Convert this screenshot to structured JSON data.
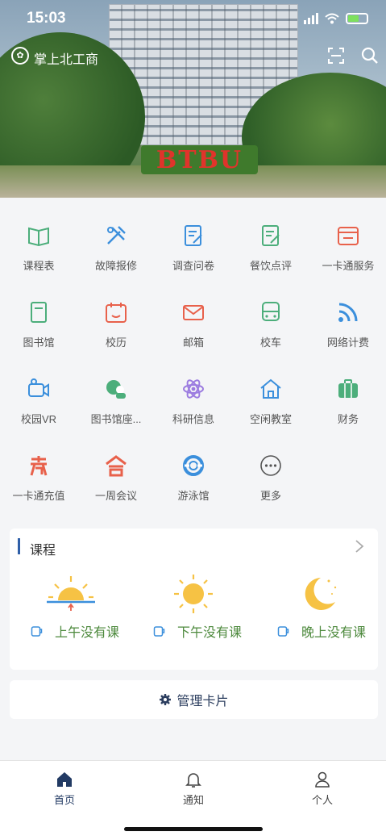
{
  "status_bar": {
    "time": "15:03"
  },
  "app_bar": {
    "title": "掌上北工商",
    "logo_glyph": "✿"
  },
  "hero": {
    "sign_text": "BTBU"
  },
  "services": [
    {
      "label": "课程表",
      "icon": "book-icon",
      "color": "#4cae7b"
    },
    {
      "label": "故障报修",
      "icon": "tools-icon",
      "color": "#3b8fdc"
    },
    {
      "label": "调查问卷",
      "icon": "survey-icon",
      "color": "#3b8fdc"
    },
    {
      "label": "餐饮点评",
      "icon": "review-icon",
      "color": "#4cae7b"
    },
    {
      "label": "一卡通服务",
      "icon": "card-service-icon",
      "color": "#e8614b"
    },
    {
      "label": "图书馆",
      "icon": "library-icon",
      "color": "#4cae7b"
    },
    {
      "label": "校历",
      "icon": "calendar-icon",
      "color": "#e8614b"
    },
    {
      "label": "邮箱",
      "icon": "mail-icon",
      "color": "#e8614b"
    },
    {
      "label": "校车",
      "icon": "bus-icon",
      "color": "#4cae7b"
    },
    {
      "label": "网络计费",
      "icon": "wifi-icon",
      "color": "#3b8fdc"
    },
    {
      "label": "校园VR",
      "icon": "vr-camera-icon",
      "color": "#3b8fdc"
    },
    {
      "label": "图书馆座...",
      "icon": "library-seat-icon",
      "color": "#4cae7b"
    },
    {
      "label": "科研信息",
      "icon": "atom-icon",
      "color": "#9b7be0"
    },
    {
      "label": "空闲教室",
      "icon": "house-icon",
      "color": "#3b8fdc"
    },
    {
      "label": "财务",
      "icon": "finance-icon",
      "color": "#4cae7b"
    },
    {
      "label": "一卡通充值",
      "icon": "recharge-icon",
      "color": "#e8614b"
    },
    {
      "label": "一周会议",
      "icon": "meeting-icon",
      "color": "#e8614b"
    },
    {
      "label": "游泳馆",
      "icon": "lifebuoy-icon",
      "color": "#3b8fdc"
    },
    {
      "label": "更多",
      "icon": "more-icon",
      "color": "#555555"
    }
  ],
  "course_card": {
    "title": "课程",
    "periods": [
      {
        "text": "上午没有课",
        "icon": "sunrise-icon"
      },
      {
        "text": "下午没有课",
        "icon": "sun-icon"
      },
      {
        "text": "晚上没有课",
        "icon": "moon-icon"
      }
    ]
  },
  "manage_card": {
    "label": "管理卡片"
  },
  "tabs": [
    {
      "label": "首页",
      "icon": "home-icon",
      "active": true
    },
    {
      "label": "通知",
      "icon": "bell-icon",
      "active": false
    },
    {
      "label": "个人",
      "icon": "person-icon",
      "active": false
    }
  ],
  "colors": {
    "accent": "#223a63",
    "green": "#4e8a3e",
    "sun": "#f6c244"
  }
}
